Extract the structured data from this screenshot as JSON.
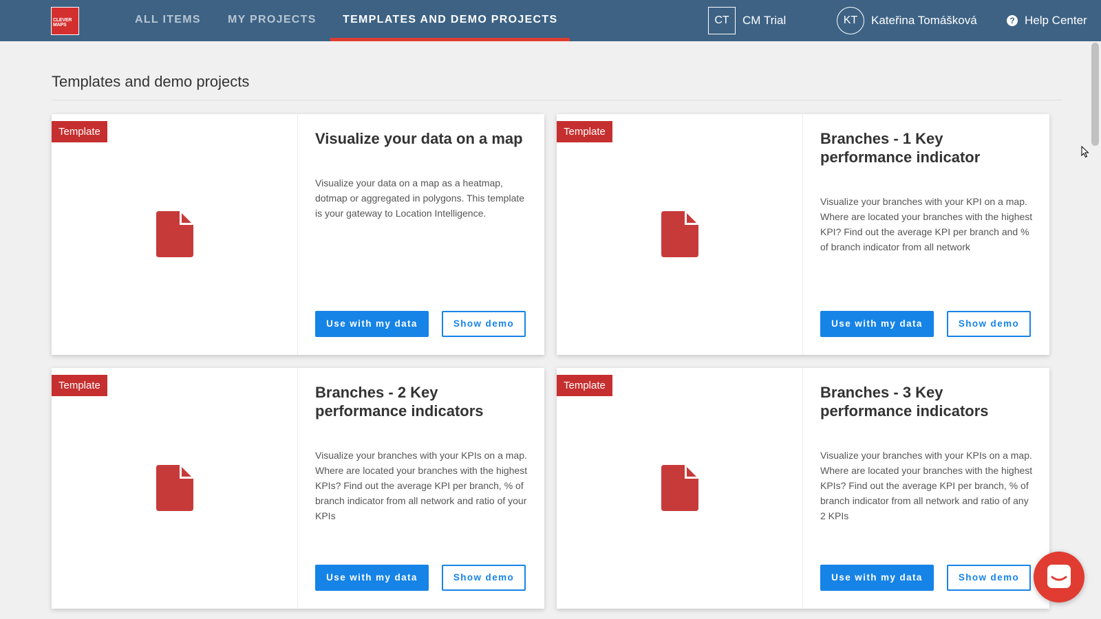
{
  "header": {
    "logo_text": "CLEVER MAPS",
    "nav": [
      {
        "label": "ALL ITEMS",
        "active": false
      },
      {
        "label": "MY PROJECTS",
        "active": false
      },
      {
        "label": "TEMPLATES AND DEMO PROJECTS",
        "active": true
      }
    ],
    "project_initials": "CT",
    "project_name": "CM Trial",
    "user_initials": "KT",
    "user_name": "Kateřina Tomášková",
    "help_icon": "question-circle-icon",
    "help_label": "Help Center"
  },
  "page": {
    "title": "Templates and demo projects"
  },
  "cards": [
    {
      "badge": "Template",
      "icon": "document-icon",
      "title": "Visualize your data on a map",
      "description": "Visualize your data on a map as a heatmap, dotmap or aggregated in polygons. This template is your gateway to Location Intelligence.",
      "primary_button": "Use with my data",
      "secondary_button": "Show demo"
    },
    {
      "badge": "Template",
      "icon": "document-icon",
      "title": "Branches - 1 Key performance indicator",
      "description": "Visualize your branches with your KPI on a map. Where are located your branches with the highest KPI? Find out the average KPI per branch and % of branch indicator from all network",
      "primary_button": "Use with my data",
      "secondary_button": "Show demo"
    },
    {
      "badge": "Template",
      "icon": "document-icon",
      "title": "Branches - 2 Key performance indicators",
      "description": "Visualize your branches with your KPIs on a map. Where are located your branches with the highest KPIs? Find out the average KPI per branch, % of branch indicator from all network and ratio of your KPIs",
      "primary_button": "Use with my data",
      "secondary_button": "Show demo"
    },
    {
      "badge": "Template",
      "icon": "document-icon",
      "title": "Branches - 3 Key performance indicators",
      "description": "Visualize your branches with your KPIs on a map. Where are located your branches with the highest KPIs? Find out the average KPI per branch, % of branch indicator from all network and ratio of any 2 KPIs",
      "primary_button": "Use with my data",
      "secondary_button": "Show demo"
    }
  ],
  "chat": {
    "icon": "chat-icon"
  },
  "colors": {
    "header_bg": "#3d6284",
    "active_tab_underline": "#e03c31",
    "badge_bg": "#c62f2f",
    "primary_button": "#1683e6",
    "file_icon": "#c73a3a"
  }
}
